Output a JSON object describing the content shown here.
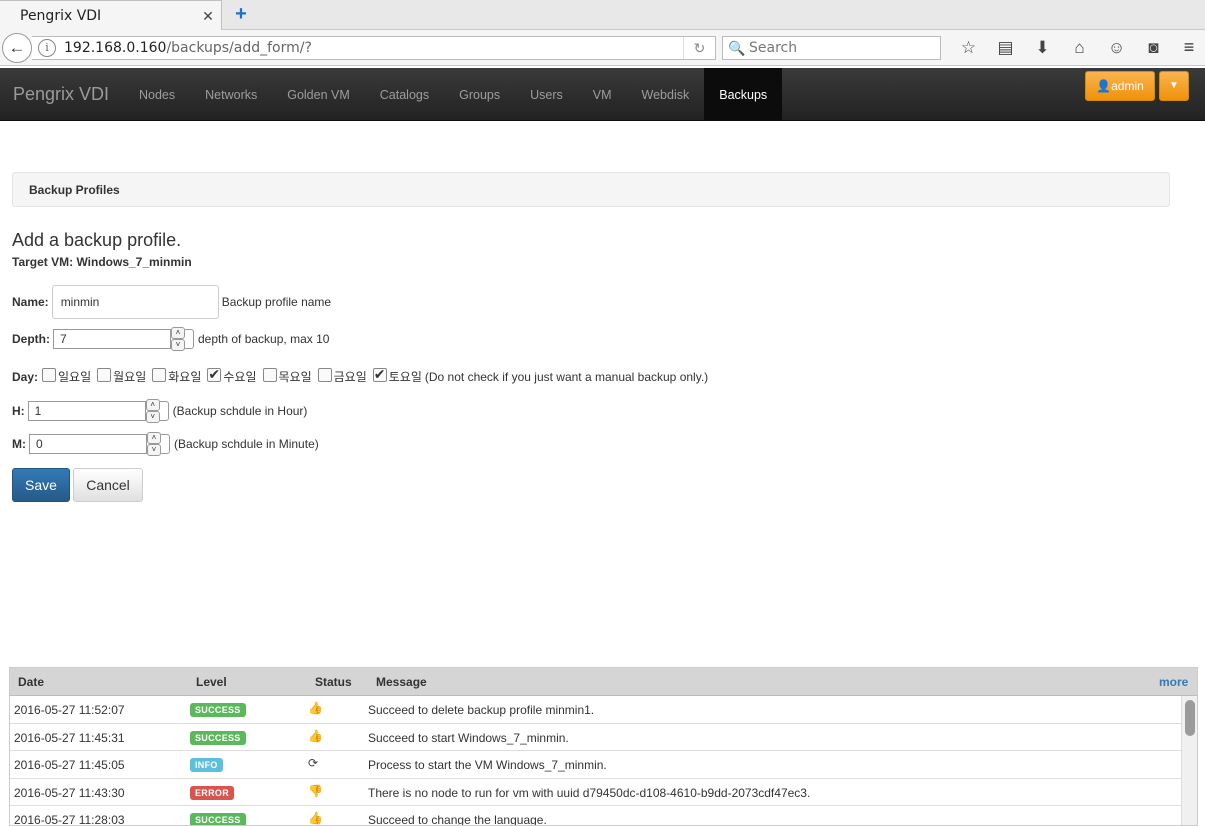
{
  "browser": {
    "tab_title": "Pengrix VDI",
    "url_host": "192.168.0.160",
    "url_path": "/backups/add_form/?",
    "search_placeholder": "Search"
  },
  "app": {
    "brand": "Pengrix VDI",
    "nav": [
      "Nodes",
      "Networks",
      "Golden VM",
      "Catalogs",
      "Groups",
      "Users",
      "VM",
      "Webdisk",
      "Backups"
    ],
    "active_nav": "Backups",
    "admin_label": "admin"
  },
  "panel_title": "Backup Profiles",
  "form": {
    "title": "Add a backup profile.",
    "target_vm": "Target VM: Windows_7_minmin",
    "name_label": "Name:",
    "name_value": "minmin",
    "name_hint": "Backup profile name",
    "depth_label": "Depth:",
    "depth_value": "7",
    "depth_hint": "depth of backup, max 10",
    "day_label": "Day:",
    "days": [
      {
        "name": "일요일",
        "checked": false
      },
      {
        "name": "월요일",
        "checked": false
      },
      {
        "name": "화요일",
        "checked": false
      },
      {
        "name": "수요일",
        "checked": true
      },
      {
        "name": "목요일",
        "checked": false
      },
      {
        "name": "금요일",
        "checked": false
      },
      {
        "name": "토요일",
        "checked": true
      }
    ],
    "day_hint": "(Do not check if you just want a manual backup only.)",
    "h_label": "H:",
    "h_value": "1",
    "h_hint": "(Backup schdule in Hour)",
    "m_label": "M:",
    "m_value": "0",
    "m_hint": "(Backup schdule in Minute)",
    "save_label": "Save",
    "cancel_label": "Cancel"
  },
  "log": {
    "headers": {
      "date": "Date",
      "level": "Level",
      "status": "Status",
      "message": "Message",
      "more": "more"
    },
    "rows": [
      {
        "date": "2016-05-27 11:52:07",
        "level": "SUCCESS",
        "level_color": "#5cb85c",
        "status_icon": "thumbs-up-icon",
        "status_glyph": "👍",
        "message": "Succeed to delete backup profile minmin1."
      },
      {
        "date": "2016-05-27 11:45:31",
        "level": "SUCCESS",
        "level_color": "#5cb85c",
        "status_icon": "thumbs-up-icon",
        "status_glyph": "👍",
        "message": "Succeed to start Windows_7_minmin."
      },
      {
        "date": "2016-05-27 11:45:05",
        "level": "INFO",
        "level_color": "#5bc0de",
        "status_icon": "refresh-icon",
        "status_glyph": "⟳",
        "message": "Process to start the VM Windows_7_minmin."
      },
      {
        "date": "2016-05-27 11:43:30",
        "level": "ERROR",
        "level_color": "#d9534f",
        "status_icon": "thumbs-down-icon",
        "status_glyph": "👎",
        "message": "There is no node to run for vm with uuid d79450dc-d108-4610-b9dd-2073cdf47ec3."
      },
      {
        "date": "2016-05-27 11:28:03",
        "level": "SUCCESS",
        "level_color": "#5cb85c",
        "status_icon": "thumbs-up-icon",
        "status_glyph": "👍",
        "message": "Succeed to change the language."
      }
    ]
  }
}
